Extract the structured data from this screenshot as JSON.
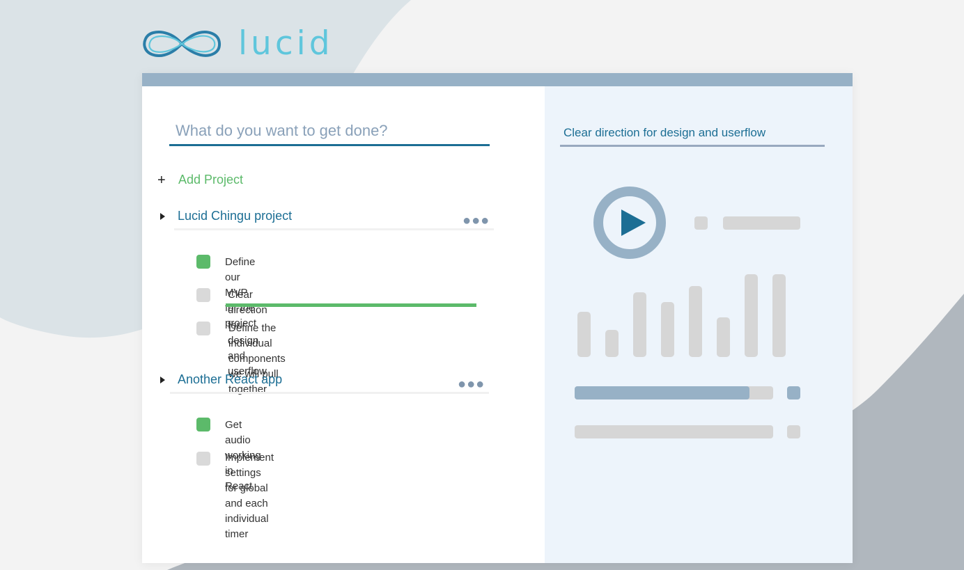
{
  "app": {
    "name": "lucid",
    "logo_icon": "infinity-icon",
    "accent_color": "#1c6e94",
    "done_color": "#5cba6a"
  },
  "search": {
    "placeholder": "What do you want to get done?",
    "value": ""
  },
  "add_project": {
    "icon": "plus-icon",
    "label": "Add Project"
  },
  "projects": [
    {
      "title": "Lucid Chingu project",
      "tasks": [
        {
          "text_line1": "Define our MVP for the",
          "text_line2": "project",
          "done": true
        },
        {
          "text_line1": "Clear direction for design and userflow",
          "done": false,
          "active": true
        },
        {
          "text_line1": "Define the individual components we will pull",
          "text_line2": "together",
          "done": false
        }
      ]
    },
    {
      "title": "Another React app",
      "tasks": [
        {
          "text_line1": "Get audio working in",
          "text_line2": "React",
          "done": true
        },
        {
          "text_line1": "Implement settings for global and each",
          "text_line2": "individual timer",
          "done": false
        }
      ]
    }
  ],
  "detail": {
    "title": "Clear direction for design and userflow",
    "play_icon": "play-icon",
    "visualizer_levels": [
      0.55,
      0.33,
      0.78,
      0.66,
      0.86,
      0.48,
      1.0,
      1.0
    ],
    "progress_fill": 0.88
  }
}
